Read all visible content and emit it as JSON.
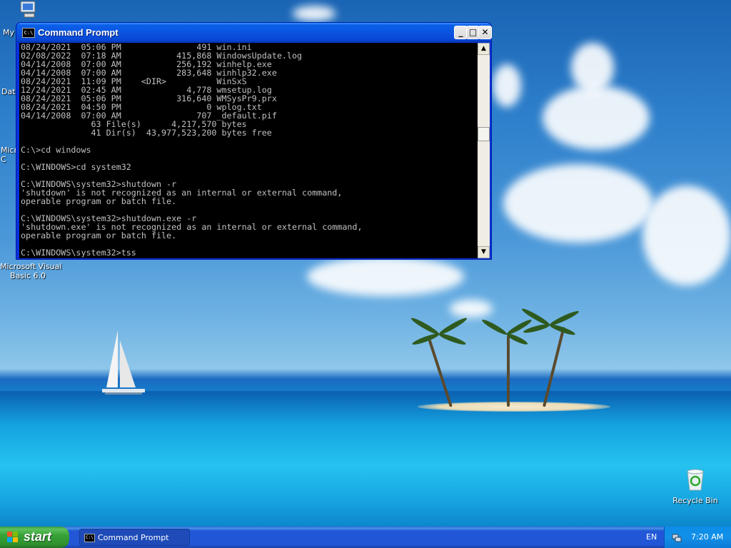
{
  "desktop": {
    "icons": [
      {
        "label": "My"
      },
      {
        "label": "Dat"
      },
      {
        "label": "Micro\nC"
      },
      {
        "label": "Microsoft Visual\nBasic 6.0"
      },
      {
        "label": "Recycle Bin"
      }
    ]
  },
  "window": {
    "title": "Command Prompt",
    "icon_text": "C:\\",
    "minimize_label": "_",
    "maximize_label": "□",
    "close_label": "✕",
    "console_lines": [
      "08/24/2021  05:06 PM               491 win.ini",
      "02/08/2022  07:18 AM           415,868 WindowsUpdate.log",
      "04/14/2008  07:00 AM           256,192 winhelp.exe",
      "04/14/2008  07:00 AM           283,648 winhlp32.exe",
      "08/24/2021  11:09 PM    <DIR>          WinSxS",
      "12/24/2021  02:45 AM             4,778 wmsetup.log",
      "08/24/2021  05:06 PM           316,640 WMSysPr9.prx",
      "08/24/2021  04:50 PM                 0 wplog.txt",
      "04/14/2008  07:00 AM               707 _default.pif",
      "              63 File(s)      4,217,570 bytes",
      "              41 Dir(s)  43,977,523,200 bytes free",
      "",
      "C:\\>cd windows",
      "",
      "C:\\WINDOWS>cd system32",
      "",
      "C:\\WINDOWS\\system32>shutdown -r",
      "'shutdown' is not recognized as an internal or external command,",
      "operable program or batch file.",
      "",
      "C:\\WINDOWS\\system32>shutdown.exe -r",
      "'shutdown.exe' is not recognized as an internal or external command,",
      "operable program or batch file.",
      "",
      "C:\\WINDOWS\\system32>tss"
    ],
    "scroll_up": "▲",
    "scroll_down": "▼"
  },
  "taskbar": {
    "start_label": "start",
    "task_label": "Command Prompt",
    "task_icon_text": "C:\\",
    "language": "EN",
    "clock": "7:20 AM"
  }
}
